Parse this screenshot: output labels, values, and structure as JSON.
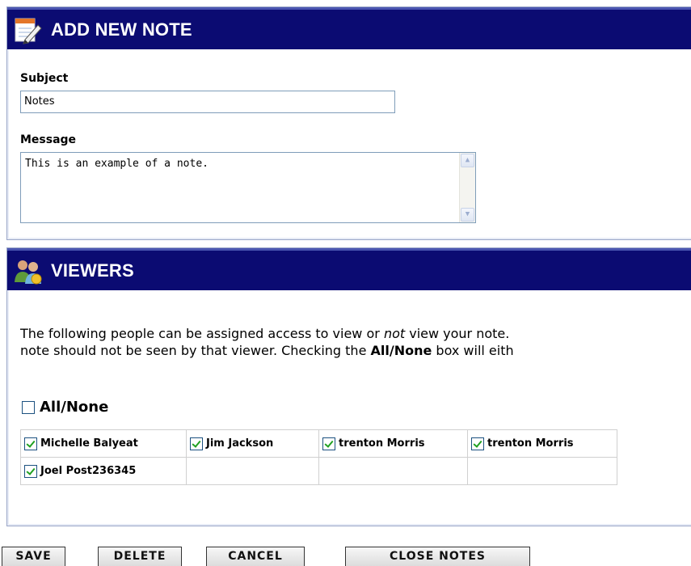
{
  "note_panel": {
    "title": "ADD NEW NOTE",
    "icon": "notepad-pencil-icon",
    "subject_label": "Subject",
    "subject_value": "Notes",
    "message_label": "Message",
    "message_value": "This is an example of a note."
  },
  "viewers_panel": {
    "title": "VIEWERS",
    "icon": "people-group-icon",
    "desc_line1_a": "The following people can be assigned access to view or ",
    "desc_line1_em": "not",
    "desc_line1_b": " view your note.",
    "desc_line2_a": "note should not be seen by that viewer. Checking the ",
    "desc_line2_strong": "All/None",
    "desc_line2_b": " box will eith",
    "all_none_label": "All/None",
    "all_none_checked": false,
    "viewers": [
      {
        "name": "Michelle Balyeat",
        "checked": true
      },
      {
        "name": "Jim Jackson",
        "checked": true
      },
      {
        "name": "trenton Morris",
        "checked": true
      },
      {
        "name": "trenton Morris",
        "checked": true
      },
      {
        "name": "Joel Post236345",
        "checked": true
      }
    ]
  },
  "buttons": {
    "save": "SAVE",
    "delete": "DELETE",
    "cancel": "CANCEL",
    "close_notes": "CLOSE NOTES"
  },
  "colors": {
    "header_bg": "#0b0b72",
    "check_green": "#21a121"
  }
}
